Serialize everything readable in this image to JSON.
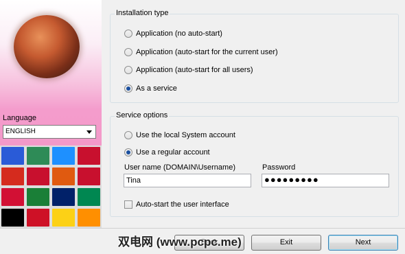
{
  "left": {
    "language_label": "Language",
    "language_value": "ENGLISH"
  },
  "installation": {
    "title": "Installation type",
    "options": [
      {
        "label": "Application (no auto-start)",
        "checked": false
      },
      {
        "label": "Application (auto-start for the current user)",
        "checked": false
      },
      {
        "label": "Application (auto-start for all users)",
        "checked": false
      },
      {
        "label": "As a service",
        "checked": true
      }
    ]
  },
  "service": {
    "title": "Service options",
    "local_system_label": "Use the local System account",
    "regular_account_label": "Use a regular account",
    "username_label": "User name (DOMAIN\\Username)",
    "username_value": "Tina",
    "password_label": "Password",
    "password_value": "●●●●●●●●●",
    "autostart_ui_label": "Auto-start the user interface"
  },
  "buttons": {
    "back": "Back",
    "exit": "Exit",
    "next": "Next"
  },
  "watermark": "双电网 (www.pcpc.me)",
  "flags": [
    "#2a5bd7",
    "#2e8b57",
    "#1e90ff",
    "#c8102e",
    "#d52b1e",
    "#c8102e",
    "#e05a10",
    "#c8102e",
    "#d21034",
    "#1a7f37",
    "#012169",
    "#008751",
    "#000000",
    "#ce1126",
    "#fcd116",
    "#ff8f00"
  ]
}
